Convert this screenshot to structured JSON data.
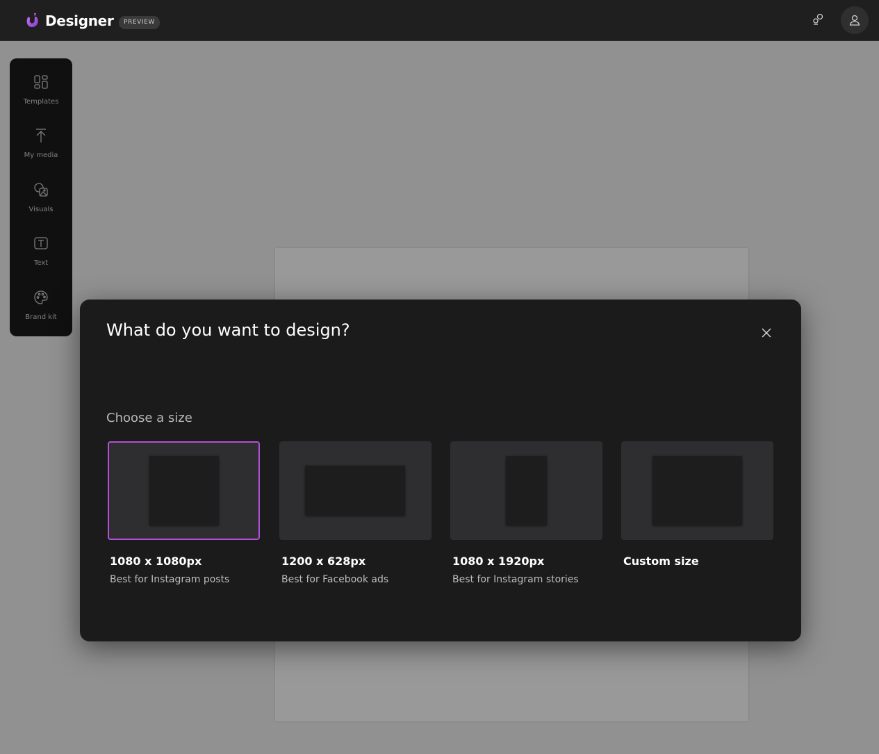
{
  "header": {
    "app_title": "Designer",
    "badge": "PREVIEW",
    "icons": [
      "designer-logo-icon",
      "share-icon",
      "user-icon"
    ]
  },
  "sidebar": {
    "items": [
      {
        "label": "Templates",
        "icon": "templates-icon"
      },
      {
        "label": "My media",
        "icon": "upload-icon"
      },
      {
        "label": "Visuals",
        "icon": "visuals-icon"
      },
      {
        "label": "Text",
        "icon": "text-icon"
      },
      {
        "label": "Brand kit",
        "icon": "palette-icon"
      }
    ]
  },
  "dialog": {
    "title": "What do you want to design?",
    "section_label": "Choose a size",
    "options": [
      {
        "title": "1080 x 1080px",
        "subtitle": "Best for Instagram posts",
        "selected": true
      },
      {
        "title": "1200 x 628px",
        "subtitle": "Best for Facebook ads",
        "selected": false
      },
      {
        "title": "1080 x 1920px",
        "subtitle": "Best for Instagram stories",
        "selected": false
      },
      {
        "title": "Custom size",
        "subtitle": "",
        "selected": false
      }
    ]
  },
  "colors": {
    "accent": "#b34fd8",
    "topbar_bg": "#1f1f1f",
    "dialog_bg": "#1b1b1b",
    "thumb_bg": "#2e2e30"
  }
}
